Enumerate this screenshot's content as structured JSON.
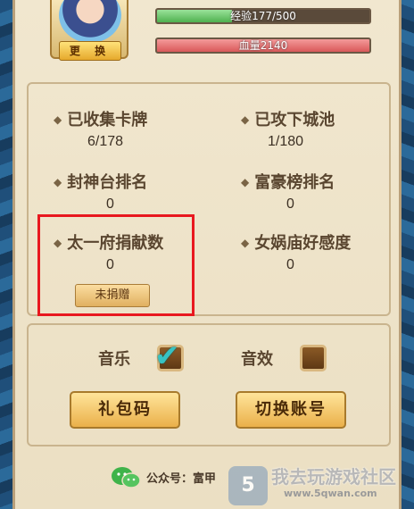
{
  "header": {
    "change_button_label": "更 换",
    "exp_label": "经验177/500",
    "exp_progress": 0.354,
    "hp_label": "血量2140",
    "hp_progress": 1.0
  },
  "stats": {
    "cards_collected": {
      "label": "已收集卡牌",
      "value": "6/178"
    },
    "cities_captured": {
      "label": "已攻下城池",
      "value": "1/180"
    },
    "fengshen_rank": {
      "label": "封神台排名",
      "value": "0"
    },
    "rich_rank": {
      "label": "富豪榜排名",
      "value": "0"
    },
    "taiyi_donation": {
      "label": "太一府捐献数",
      "value": "0",
      "button_label": "未捐赠"
    },
    "nvwa_favor": {
      "label": "女娲庙好感度",
      "value": "0"
    }
  },
  "settings": {
    "music_label": "音乐",
    "music_checked": true,
    "sound_label": "音效",
    "sound_checked": false,
    "gift_code_button": "礼包码",
    "switch_account_button": "切换账号"
  },
  "footer": {
    "official_account_text": "公众号：富甲"
  },
  "watermark": {
    "title": "我去玩游戏社区",
    "url": "www.5qwan.com"
  },
  "colors": {
    "highlight_box": "#e8181f",
    "exp_fill": "#4fb14f",
    "hp_fill": "#d9595a",
    "check_mark": "#37c2c2"
  },
  "icons": {
    "check": "check-icon",
    "wechat": "wechat-icon",
    "diamond": "diamond-bullet-icon"
  }
}
